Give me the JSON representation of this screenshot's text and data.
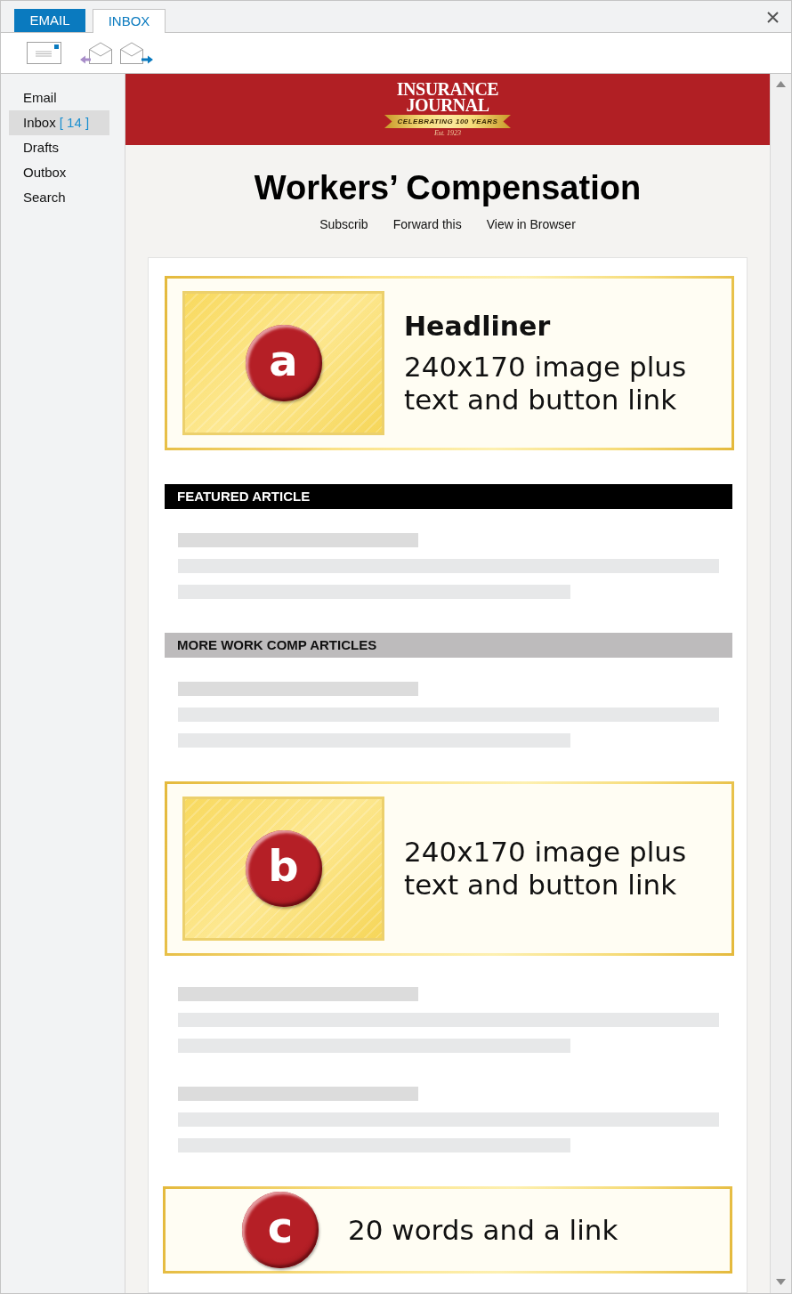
{
  "tabs": [
    {
      "label": "EMAIL",
      "kind": "menu",
      "selected": false
    },
    {
      "label": "INBOX",
      "kind": "tab",
      "selected": true
    }
  ],
  "toolbar": [
    {
      "kind": "compose"
    },
    {
      "kind": "reply"
    },
    {
      "kind": "forward"
    }
  ],
  "sidebar": {
    "items": [
      {
        "label": "Email",
        "selected": false
      },
      {
        "label": "Inbox",
        "count": "[ 14 ]",
        "selected": true
      },
      {
        "label": "Drafts",
        "selected": false
      },
      {
        "label": "Outbox",
        "selected": false
      },
      {
        "label": "Search",
        "selected": false
      }
    ]
  },
  "email": {
    "logo": {
      "wordmark": [
        "INSURANCE",
        "JOURNAL"
      ],
      "ribbon": "CELEBRATING 100 YEARS",
      "established": "Est. 1923"
    },
    "title": "Workers’ Compensation",
    "links": [
      "Subscrib",
      "Forward this",
      "View in Browser"
    ],
    "blocks": [
      {
        "kind": "promo",
        "badge": "a",
        "title": "Headliner",
        "lines": [
          "240x170 image plus",
          "text and button link"
        ]
      },
      {
        "kind": "featured",
        "label": "FEATURED ARTICLE"
      },
      {
        "kind": "placeholder"
      },
      {
        "kind": "section",
        "label": "MORE WORK COMP ARTICLES"
      },
      {
        "kind": "placeholder"
      },
      {
        "kind": "promo",
        "badge": "b",
        "lines": [
          "240x170 image plus",
          "text and button link"
        ]
      },
      {
        "kind": "placeholder"
      },
      {
        "kind": "placeholder"
      },
      {
        "kind": "callout",
        "badge": "c",
        "text": "20 words and a link"
      }
    ]
  }
}
